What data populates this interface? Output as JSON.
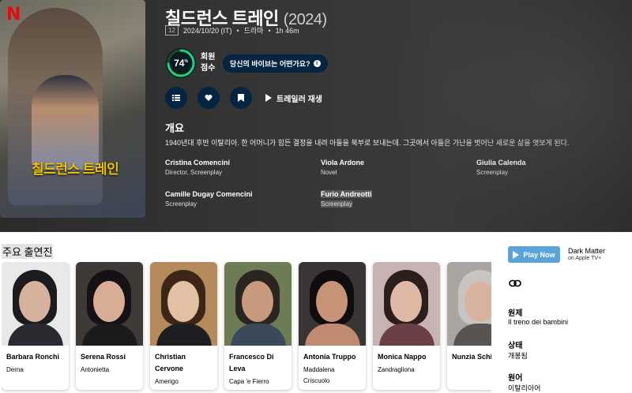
{
  "movie": {
    "title": "칠드런스 트레인",
    "year": "(2024)",
    "certification": "12",
    "release": "2024/10/20 (IT)",
    "genre": "드라마",
    "runtime": "1h 46m",
    "poster_brand": "N",
    "poster_title": "칠드런스 트레인"
  },
  "score": {
    "value": "74",
    "percent_sign": "%",
    "percent": 74,
    "label_line1": "회원",
    "label_line2": "점수",
    "ring_color": "#21d07a",
    "vibe_text": "당신의 바이브는 어떤가요?",
    "vibe_info": "i"
  },
  "actions": {
    "list_icon": "list-icon",
    "heart_icon": "heart-icon",
    "bookmark_icon": "bookmark-icon",
    "trailer_label": "트레일러 재생"
  },
  "overview": {
    "heading": "개요",
    "text": "1940년대 후반 이탈리아. 한 어머니가 힘든 결정을 내려 아들을 북부로 보내는데. 그곳에서 아들은 가난을 벗어난 새로운 삶을 엿보게 된다."
  },
  "crew": [
    {
      "name": "Cristina Comencini",
      "job": "Director, Screenplay"
    },
    {
      "name": "Viola Ardone",
      "job": "Novel"
    },
    {
      "name": "Giulia Calenda",
      "job": "Screenplay"
    },
    {
      "name": "Camille Dugay Comencini",
      "job": "Screenplay"
    },
    {
      "name": "Furio Andreotti",
      "job": "Screenplay"
    }
  ],
  "cast_heading": "주요 출연진",
  "cast": [
    {
      "name": "Barbara Ronchi",
      "role": "Derna"
    },
    {
      "name": "Serena Rossi",
      "role": "Antonietta"
    },
    {
      "name": "Christian Cervone",
      "role": "Amerigo"
    },
    {
      "name": "Francesco Di Leva",
      "role": "Capa 'e Fierro"
    },
    {
      "name": "Antonia Truppo",
      "role": "Maddalena Criscuolo"
    },
    {
      "name": "Monica Nappo",
      "role": "Zandragliona"
    },
    {
      "name": "Nunzia Schi",
      "role": ""
    }
  ],
  "sidebar": {
    "play_now": "Play Now",
    "provider": "Dark Matter",
    "provider_sub": "on Apple TV+",
    "link_icon": "link-icon",
    "original_title_label": "원제",
    "original_title": "Il treno dei bambini",
    "status_label": "상태",
    "status": "개봉됨",
    "language_label": "원어",
    "language": "이탈리아어"
  },
  "colors": {
    "accent": "#032541",
    "play_button": "#5aa4d9",
    "poster_netflix": "#e50914"
  }
}
